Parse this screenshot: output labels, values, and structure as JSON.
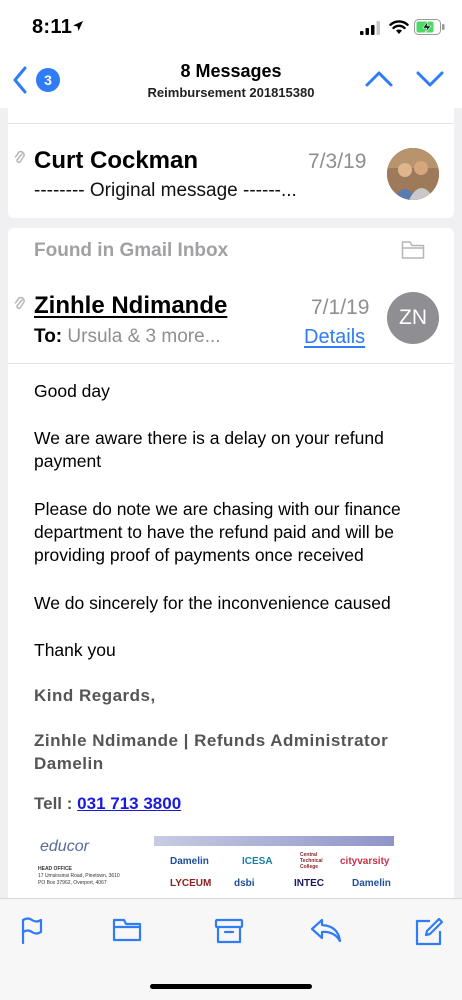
{
  "status_bar": {
    "time": "8:11"
  },
  "nav": {
    "back_count": "3",
    "title": "8 Messages",
    "subtitle": "Reimbursement 201815380"
  },
  "message1": {
    "sender": "Curt Cockman",
    "date": "7/3/19",
    "preview": "-------- Original message ------..."
  },
  "message2": {
    "found_in": "Found in Gmail Inbox",
    "sender": "Zinhle Ndimande",
    "date": "7/1/19",
    "to_label": "To:",
    "to_value": "Ursula & 3 more...",
    "details_label": "Details",
    "avatar_initials": "ZN",
    "body": {
      "greeting": "Good day",
      "p1": "We are aware there is a delay on your refund payment",
      "p2": "Please do note we are chasing with our finance department to have the refund  paid and will be providing proof of payments once received",
      "p3": "We do sincerely for the inconvenience caused",
      "thanks": "Thank you",
      "regards": "Kind Regards,",
      "signature": "Zinhle Ndimande | Refunds Administrator Damelin",
      "tel_label": "Tell :",
      "tel_number": "031 713 3800"
    },
    "banner": {
      "educor": "educor",
      "head_office": "HEAD OFFICE",
      "address": "17 Umsinsinsi Road, Pinetown, 3610",
      "po_box": "PO Box 37962, Overport, 4067",
      "logos": [
        "Damelin",
        "ICESA",
        "Central Technical College",
        "cityvarsity",
        "LYCEUM",
        "dsbi",
        "INTEC",
        "Damelin"
      ]
    }
  },
  "colors": {
    "accent": "#2f7cf6",
    "secondary_text": "#8e8e93",
    "link": "#1a1adf"
  },
  "toolbar": {
    "icons": [
      "flag-icon",
      "folder-icon",
      "archive-icon",
      "reply-icon",
      "compose-icon"
    ]
  }
}
